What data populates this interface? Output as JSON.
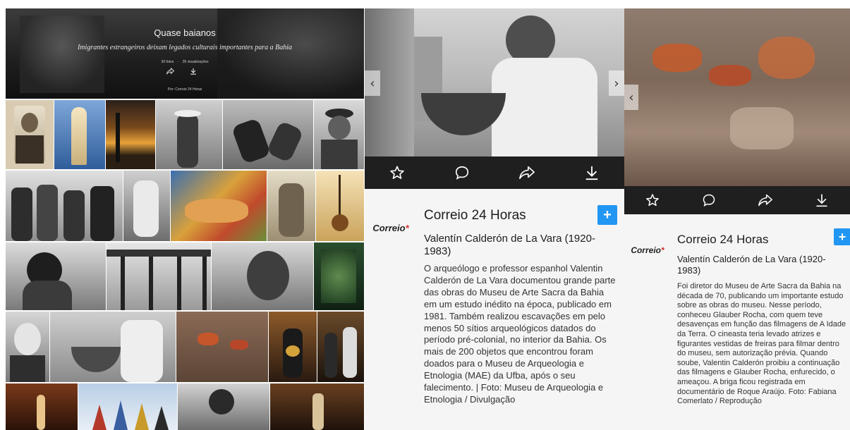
{
  "album": {
    "title": "Quase baianos",
    "subtitle": "Imigrantes estrangeiros deixam legados culturais importantes para a Bahia",
    "photo_count": "39 fotos",
    "separator": "·",
    "views": "35 visualizações",
    "credit": "Por: Correio 24 Horas"
  },
  "panel_left": {
    "author": "Correio 24 Horas",
    "logo_text": "Correio",
    "logo_mark": "*",
    "plus_label": "+",
    "caption_title": "Valentín Calderón de La Vara (1920-1983)",
    "caption_text": "O arqueólogo e professor espanhol Valentin Calderón de La Vara documentou grande parte das obras do Museu de Arte Sacra da Bahia em um estudo inédito na época, publicado em 1981. Também realizou escavações em pelo menos 50 sítios arqueológicos datados do período pré-colonial, no interior da Bahia. Os mais de 200 objetos que encontrou foram doados para o Museu de Arqueologia e Etnologia (MAE) da Ufba, após o seu falecimento. | Foto: Museu de Arqueologia e Etnologia / Divulgação"
  },
  "panel_right": {
    "author": "Correio 24 Horas",
    "logo_text": "Correio",
    "logo_mark": "*",
    "plus_label": "+",
    "caption_title": "Valentín Calderón de La Vara (1920-1983)",
    "caption_text": "Foi diretor do Museu de Arte Sacra da Bahia na década de 70, publicando um importante estudo sobre as obras do museu. Nesse período, conheceu Glauber Rocha, com quem teve desavenças em função das filmagens de A Idade da Terra. O cineasta teria levado atrizes e figurantes vestidas de freiras para filmar dentro do museu, sem autorização prévia. Quando soube, Valentin Calderón proibiu a continuação das filmagens e Glauber Rocha, enfurecido, o ameaçou. A briga ficou registrada em documentário de Roque Araújo. Foto: Fabiana Comerlato / Reprodução"
  },
  "icons": {
    "star": "star-icon",
    "comment": "comment-icon",
    "share": "share-icon",
    "download": "download-icon",
    "prev": "chevron-left-icon",
    "next": "chevron-right-icon"
  },
  "colors": {
    "accent": "#2196f3",
    "toolbar": "#1f1f1f",
    "logo_mark": "#d32f2f"
  }
}
